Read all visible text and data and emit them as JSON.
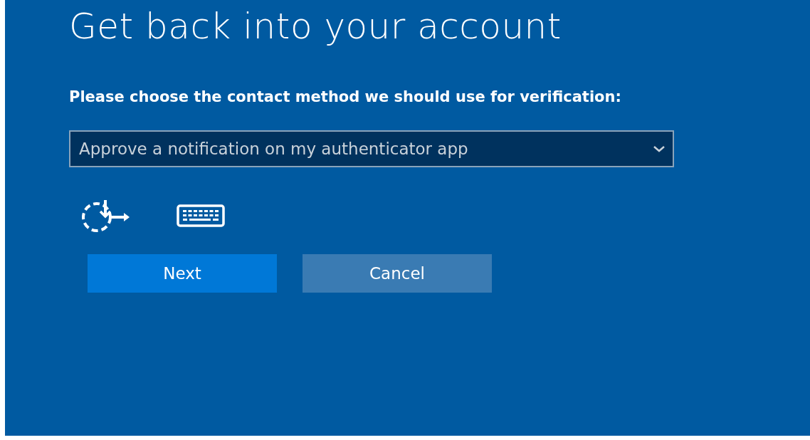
{
  "title": "Get back into your account",
  "prompt": "Please choose the contact method we should use for verification:",
  "method_select": {
    "value": "Approve a notification on my authenticator app"
  },
  "buttons": [
    {
      "label": "Next",
      "kind": "primary"
    },
    {
      "label": "Cancel",
      "kind": "secondary"
    }
  ]
}
